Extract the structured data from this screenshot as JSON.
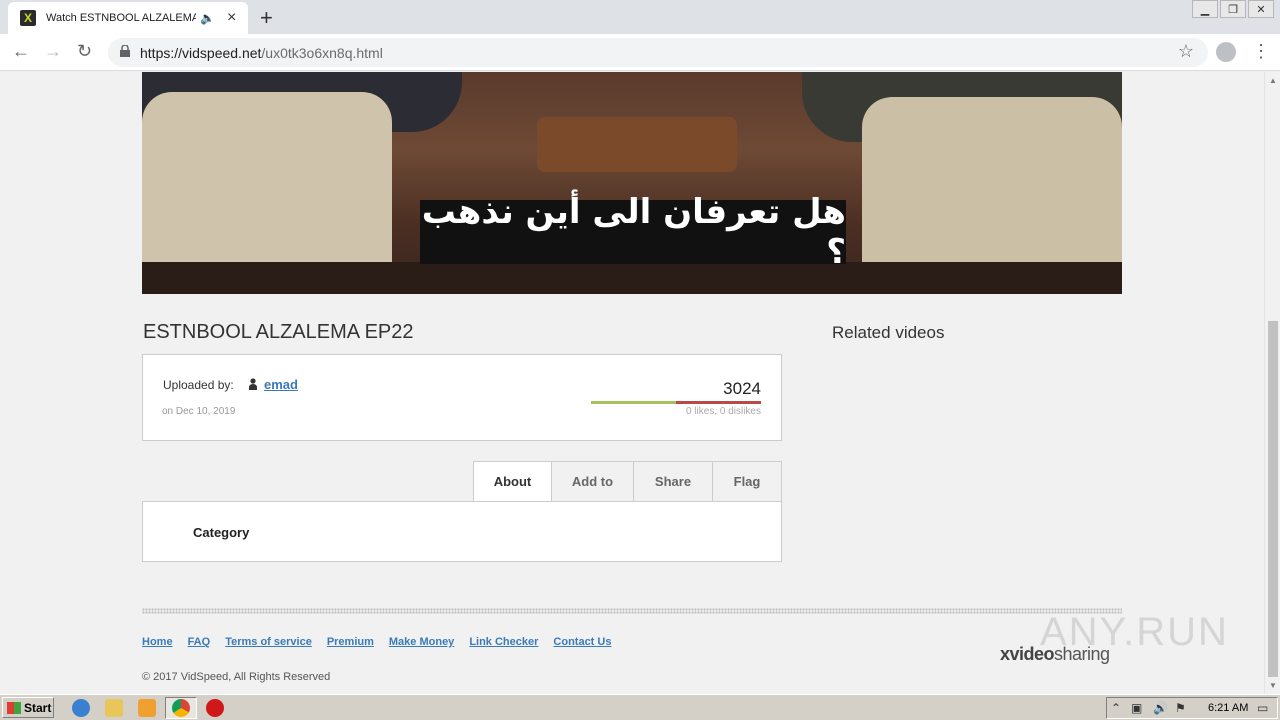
{
  "browser": {
    "tab_title": "Watch ESTNBOOL ALZALEMA EP22",
    "favicon_letter": "X",
    "url_domain": "https://vidspeed.net",
    "url_path": "/ux0tk3o6xn8q.html"
  },
  "video": {
    "subtitle": "هل تعرفان الى أين نذهب ؟"
  },
  "page": {
    "title": "ESTNBOOL ALZALEMA EP22",
    "related_title": "Related videos",
    "uploaded_label": "Uploaded by:",
    "uploader": "emad",
    "upload_date": "on Dec 10, 2019",
    "views": "3024",
    "likes_text": "0 likes, 0 dislikes",
    "likes_ratio": 0.5,
    "tabs": [
      {
        "label": "About",
        "active": true
      },
      {
        "label": "Add to",
        "active": false
      },
      {
        "label": "Share",
        "active": false
      },
      {
        "label": "Flag",
        "active": false
      }
    ],
    "category_label": "Category"
  },
  "footer": {
    "links": [
      "Home",
      "FAQ",
      "Terms of service",
      "Premium",
      "Make Money",
      "Link Checker",
      "Contact Us"
    ],
    "copyright": "© 2017 VidSpeed, All Rights Reserved",
    "logo_bold": "xvideo",
    "logo_light": "sharing"
  },
  "watermark": "ANY.RUN",
  "taskbar": {
    "start_label": "Start",
    "clock": "6:21 AM"
  },
  "colors": {
    "link": "#3a7ab8",
    "like_bar": "#a8c060",
    "dislike_bar": "#b94a48"
  }
}
